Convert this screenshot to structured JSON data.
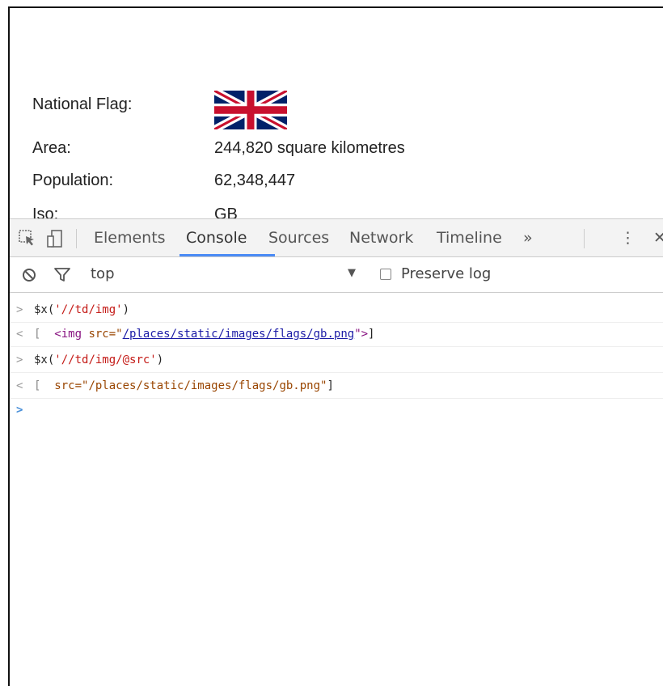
{
  "page": {
    "rows": [
      {
        "label": "National Flag:"
      },
      {
        "label": "Area:",
        "value": "244,820 square kilometres"
      },
      {
        "label": "Population:",
        "value": "62,348,447"
      },
      {
        "label": "Iso:",
        "value": "GB"
      }
    ]
  },
  "devtools": {
    "tabs": [
      "Elements",
      "Console",
      "Sources",
      "Network",
      "Timeline"
    ],
    "active_tab": "Console",
    "more_tabs": "»",
    "menu": "⋮",
    "close": "✕",
    "accent_color": "#4b8bf5",
    "filter": {
      "context": "top",
      "preserve_log_label": "Preserve log",
      "preserve_log_checked": false
    },
    "console": {
      "line1": {
        "prefix": ">",
        "fn": "$x(",
        "arg": "'//td/img'",
        "close": ")"
      },
      "line2": {
        "prefix": "<",
        "open": "[",
        "tag_open": "<img",
        "attr": "src=\"",
        "link": "/places/static/images/flags/gb.png",
        "attr_close": "\">",
        "close": "]"
      },
      "line3": {
        "prefix": ">",
        "fn": "$x(",
        "arg": "'//td/img/@src'",
        "close": ")"
      },
      "line4": {
        "prefix": "<",
        "open": "[",
        "value": "src=\"/places/static/images/flags/gb.png\"",
        "close": "]"
      },
      "prompt": ">"
    }
  }
}
